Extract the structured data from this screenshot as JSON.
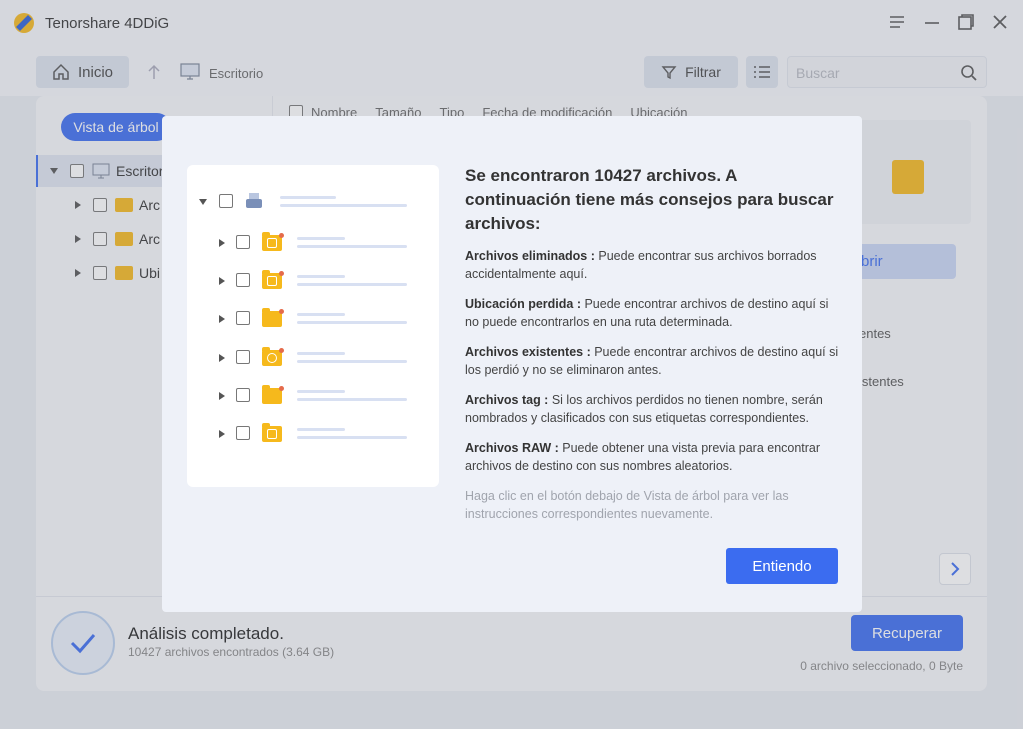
{
  "app": {
    "title": "Tenorshare 4DDiG"
  },
  "toolbar": {
    "home_label": "Inicio",
    "breadcrumb": "Escritorio",
    "filter_label": "Filtrar",
    "search_placeholder": "Buscar"
  },
  "tree": {
    "tree_view_label": "Vista de árbol",
    "items": [
      {
        "label": "Escritor",
        "icon": "desktop-icon"
      },
      {
        "label": "Arc",
        "icon": "folder-icon"
      },
      {
        "label": "Arc",
        "icon": "trash-folder-icon"
      },
      {
        "label": "Ubi",
        "icon": "location-folder-icon"
      }
    ]
  },
  "columns": [
    "Nombre",
    "Tamaño",
    "Tipo",
    "Fecha de modificación",
    "Ubicación"
  ],
  "preview": {
    "open_label": "Abrir",
    "side_labels": [
      "entes",
      "istentes"
    ]
  },
  "status": {
    "title": "Análisis completado.",
    "subtitle": "10427 archivos encontrados (3.64 GB)",
    "recover_label": "Recuperar",
    "selected_info": "0 archivo seleccionado, 0 Byte"
  },
  "modal": {
    "title": "Se encontraron 10427 archivos. A continuación tiene más consejos para buscar archivos:",
    "tips": [
      {
        "term": "Archivos eliminados :",
        "text": " Puede encontrar sus archivos borrados accidentalmente aquí."
      },
      {
        "term": "Ubicación perdida :",
        "text": " Puede encontrar archivos de destino aquí si no puede encontrarlos en una ruta determinada."
      },
      {
        "term": "Archivos existentes :",
        "text": " Puede encontrar archivos de destino aquí si los perdió y no se eliminaron antes."
      },
      {
        "term": "Archivos tag :",
        "text": " Si los archivos perdidos no tienen nombre, serán nombrados y clasificados con sus etiquetas correspondientes."
      },
      {
        "term": "Archivos RAW :",
        "text": " Puede obtener una vista previa para encontrar archivos de destino con sus nombres aleatorios."
      }
    ],
    "hint": "Haga clic en el botón debajo de Vista de árbol para ver las instrucciones correspondientes nuevamente.",
    "ok_label": "Entiendo"
  },
  "colors": {
    "accent": "#3b6cf0",
    "folder": "#f6b91c"
  }
}
